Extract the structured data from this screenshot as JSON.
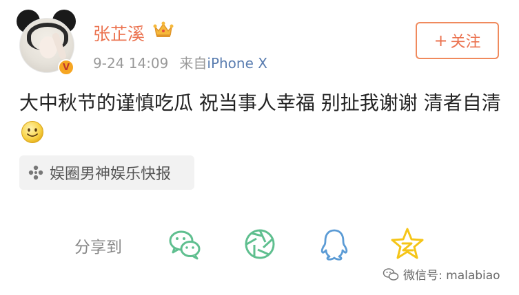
{
  "user": {
    "name": "张芷溪",
    "verified_badge": "V"
  },
  "meta": {
    "time": "9-24 14:09",
    "from_label": "来自",
    "device": "iPhone X"
  },
  "follow": {
    "plus": "+",
    "label": "关注"
  },
  "post": {
    "text": "大中秋节的谨慎吃瓜 祝当事人幸福 别扯我谢谢 清者自清",
    "emoji_icon": "smile-emoji-icon"
  },
  "topic": {
    "label": "娱圈男神娱乐快报",
    "icon": "topic-pinwheel-icon"
  },
  "share": {
    "label": "分享到",
    "targets": [
      "wechat-icon",
      "moments-icon",
      "qq-icon",
      "qzone-icon"
    ]
  },
  "watermark": {
    "text": "微信号: malabiao"
  },
  "colors": {
    "username": "#eb7350",
    "follow_border": "#f08a5d",
    "device_link": "#5a7db0",
    "wechat": "#5fbf8f",
    "moments": "#5fbf8f",
    "qq": "#5b9bd5",
    "qzone": "#f5c518"
  }
}
